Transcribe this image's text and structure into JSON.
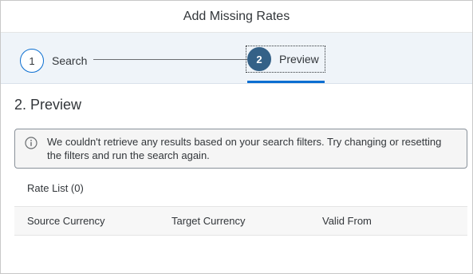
{
  "dialog": {
    "title": "Add Missing Rates"
  },
  "wizard": {
    "steps": [
      {
        "number": "1",
        "label": "Search",
        "active": false
      },
      {
        "number": "2",
        "label": "Preview",
        "active": true
      }
    ]
  },
  "page": {
    "title": "2. Preview"
  },
  "message": {
    "icon": "info-icon",
    "text": "We couldn't retrieve any results based on your search filters. Try changing or resetting the filters and run the search again."
  },
  "table": {
    "title": "Rate List (0)",
    "columns": [
      "Source Currency",
      "Target Currency",
      "Valid From"
    ]
  },
  "colors": {
    "accent": "#0a6ed1",
    "active_step": "#346187",
    "wizard_background": "#eff4f9"
  }
}
